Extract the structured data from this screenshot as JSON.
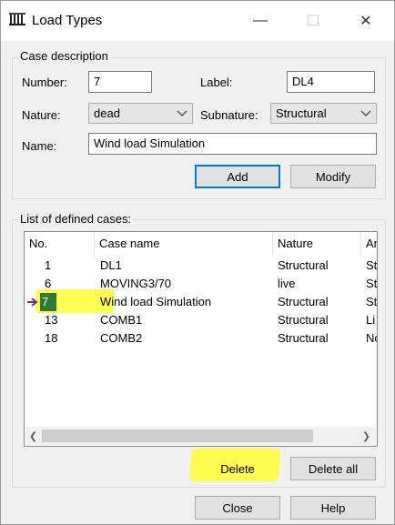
{
  "window": {
    "title": "Load Types",
    "minimize_glyph": "—",
    "maximize_glyph": "☐",
    "close_glyph": "✕",
    "icon": "load-types-icon"
  },
  "case_description": {
    "legend": "Case description",
    "number_label": "Number:",
    "number_value": "7",
    "label_label": "Label:",
    "label_value": "DL4",
    "nature_label": "Nature:",
    "nature_value": "dead",
    "subnature_label": "Subnature:",
    "subnature_value": "Structural",
    "name_label": "Name:",
    "name_value": "Wind load Simulation",
    "add_button": "Add",
    "modify_button": "Modify"
  },
  "cases_list": {
    "legend": "List of defined cases:",
    "columns": [
      "No.",
      "Case name",
      "Nature",
      "An"
    ],
    "rows": [
      {
        "no": "1",
        "name": "DL1",
        "nature": "Structural",
        "an": "St"
      },
      {
        "no": "6",
        "name": "MOVING3/70",
        "nature": "live",
        "an": "St"
      },
      {
        "no": "7",
        "name": "Wind load Simulation",
        "nature": "Structural",
        "an": "St"
      },
      {
        "no": "13",
        "name": "COMB1",
        "nature": "Structural",
        "an": "Li"
      },
      {
        "no": "18",
        "name": "COMB2",
        "nature": "Structural",
        "an": "No"
      }
    ],
    "delete_button": "Delete",
    "delete_all_button": "Delete all"
  },
  "footer": {
    "close_button": "Close",
    "help_button": "Help"
  },
  "colors": {
    "highlight": "#ffff33",
    "selected_cell": "#2e7d32",
    "default_button_border": "#0078d7",
    "pointer_arrow": "#7b2a7b"
  }
}
